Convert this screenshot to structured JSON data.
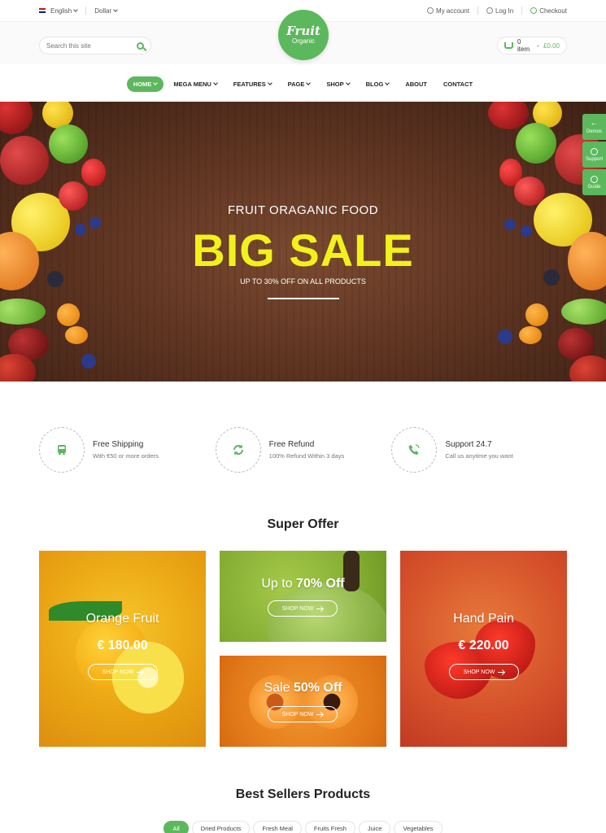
{
  "topbar": {
    "language": "English",
    "currency": "Dollar",
    "my_account": "My account",
    "login": "Log In",
    "checkout": "Checkout"
  },
  "header": {
    "search_placeholder": "Search this site",
    "logo_line1": "Fruit",
    "logo_line2": "Organic",
    "cart_items": "0 item",
    "cart_total": "£0.00"
  },
  "nav": {
    "items": [
      "HOME",
      "MEGA MENU",
      "FEATURES",
      "PAGE",
      "SHOP",
      "BLOG",
      "ABOUT",
      "CONTACT"
    ]
  },
  "hero": {
    "subtitle": "FRUIT ORAGANIC FOOD",
    "title": "BIG SALE",
    "tagline": "UP TO 30% OFF ON ALL PRODUCTS"
  },
  "sidetools": [
    "Demos",
    "Support",
    "Guide"
  ],
  "features": [
    {
      "title": "Free Shipping",
      "desc": "With €50 or more orders"
    },
    {
      "title": "Free Refund",
      "desc": "100% Refund Within 3 days"
    },
    {
      "title": "Support 24.7",
      "desc": "Call us anytime you want"
    }
  ],
  "super_offer": {
    "title": "Super Offer",
    "card1": {
      "name": "Orange Fruit",
      "price": "€ 180.00",
      "button": "SHOP NOW"
    },
    "card2": {
      "prefix": "Up to ",
      "highlight": "70% Off",
      "button": "SHOP NOW"
    },
    "card3": {
      "prefix": "Sale ",
      "highlight": "50% Off",
      "button": "SHOP NOW"
    },
    "card4": {
      "name": "Hand Pain",
      "price": "€ 220.00",
      "button": "SHOP NOW"
    }
  },
  "best_sellers": {
    "title": "Best Sellers Products",
    "tabs": [
      "All",
      "Dried Products",
      "Fresh Meal",
      "Fruits Fresh",
      "Juice",
      "Vegetables"
    ]
  },
  "colors": {
    "accent": "#5cb85c",
    "hero_title": "#f2f21b"
  }
}
